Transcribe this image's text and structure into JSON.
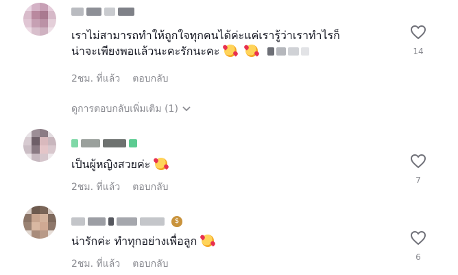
{
  "comments": [
    {
      "text_line1": "เราไม่สามารถทำให้ถูกใจทุกคนได้ค่ะแค่เรารู้ว่าเราทำไรก็",
      "text_line2": "น่าจะเพียงพอแล้วนะคะรักนะคะ",
      "time": "2ชม. ที่แล้ว",
      "reply_label": "ตอบกลับ",
      "likes": "14",
      "more_replies": "ดูการตอบกลับเพิ่มเติม (1)"
    },
    {
      "text_line1": "เป็นผู้หญิงสวยค่ะ",
      "time": "2ชม. ที่แล้ว",
      "reply_label": "ตอบกลับ",
      "likes": "7"
    },
    {
      "text_line1": "น่ารักค่ะ ทำทุกอย่างเพื่อลูก",
      "time": "2ชม. ที่แล้ว",
      "reply_label": "ตอบกลับ",
      "likes": "6"
    }
  ],
  "icons": {
    "like": "heart-outline-icon",
    "expand": "chevron-down-icon",
    "emoji": "smiling-face-with-hearts-icon",
    "badge": "money-bag-icon"
  },
  "colors": {
    "text": "#161823",
    "secondary": "#8a8b91",
    "background": "#ffffff"
  }
}
